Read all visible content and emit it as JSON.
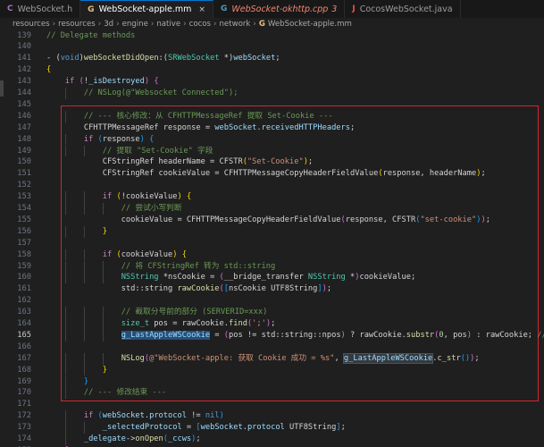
{
  "tabs": [
    {
      "icon": "C",
      "icon_color": "#a074c4",
      "label": "WebSocket.h",
      "active": false
    },
    {
      "icon": "G",
      "icon_color": "#e5c07b",
      "label": "WebSocket-apple.mm",
      "active": true,
      "close": "×"
    },
    {
      "icon": "G",
      "icon_color": "#519aba",
      "label": "WebSocket-okhttp.cpp",
      "problems": "3",
      "active": false,
      "error": true
    },
    {
      "icon": "J",
      "icon_color": "#f14c4c",
      "label": "CocosWebSocket.java",
      "active": false
    }
  ],
  "breadcrumb": [
    "resources",
    "resources",
    "3d",
    "engine",
    "native",
    "cocos",
    "network",
    "WebSocket-apple.mm"
  ],
  "active_line": 165,
  "lines": [
    {
      "n": 139,
      "t": [
        [
          "cm",
          "// Delegate methods"
        ]
      ]
    },
    {
      "n": 140,
      "t": []
    },
    {
      "n": 141,
      "t": [
        [
          "pl",
          "- ("
        ],
        [
          "kw",
          "void"
        ],
        [
          "pl",
          ")"
        ],
        [
          "fn",
          "webSocketDidOpen"
        ],
        [
          "pl",
          ":("
        ],
        [
          "ty",
          "SRWebSocket"
        ],
        [
          "pl",
          " *)"
        ],
        [
          "var",
          "webSocket"
        ],
        [
          "pl",
          ";"
        ]
      ]
    },
    {
      "n": 142,
      "t": [
        [
          "b1",
          "{"
        ]
      ]
    },
    {
      "n": 143,
      "t": [
        [
          "pl",
          "    "
        ],
        [
          "ctl",
          "if"
        ],
        [
          "pl",
          " "
        ],
        [
          "b2",
          "("
        ],
        [
          "pl",
          "!"
        ],
        [
          "var",
          "_isDestroyed"
        ],
        [
          "b2",
          ")"
        ],
        [
          "pl",
          " "
        ],
        [
          "b2",
          "{"
        ]
      ]
    },
    {
      "n": 144,
      "t": [
        [
          "pl",
          "        "
        ],
        [
          "cm",
          "// NSLog(@\"Websocket Connected\");"
        ]
      ]
    },
    {
      "n": 145,
      "t": []
    },
    {
      "n": 146,
      "t": [
        [
          "pl",
          "        "
        ],
        [
          "cm",
          "// --- 核心修改：从 CFHTTPMessageRef 提取 Set-Cookie ---"
        ]
      ]
    },
    {
      "n": 147,
      "t": [
        [
          "pl",
          "        CFHTTPMessageRef response = "
        ],
        [
          "var",
          "webSocket"
        ],
        [
          "pl",
          "."
        ],
        [
          "var",
          "receivedHTTPHeaders"
        ],
        [
          "pl",
          ";"
        ]
      ]
    },
    {
      "n": 148,
      "t": [
        [
          "pl",
          "        "
        ],
        [
          "ctl",
          "if"
        ],
        [
          "pl",
          " "
        ],
        [
          "b3",
          "("
        ],
        [
          "pl",
          "response"
        ],
        [
          "b3",
          ")"
        ],
        [
          "pl",
          " "
        ],
        [
          "b3",
          "{"
        ]
      ]
    },
    {
      "n": 149,
      "t": [
        [
          "pl",
          "            "
        ],
        [
          "cm",
          "// 提取 \"Set-Cookie\" 字段"
        ]
      ]
    },
    {
      "n": 150,
      "t": [
        [
          "pl",
          "            CFStringRef headerName = CFSTR"
        ],
        [
          "b1",
          "("
        ],
        [
          "str",
          "\"Set-Cookie\""
        ],
        [
          "b1",
          ")"
        ],
        [
          "pl",
          ";"
        ]
      ]
    },
    {
      "n": 151,
      "t": [
        [
          "pl",
          "            CFStringRef cookieValue = CFHTTPMessageCopyHeaderFieldValue"
        ],
        [
          "b1",
          "("
        ],
        [
          "pl",
          "response, headerName"
        ],
        [
          "b1",
          ")"
        ],
        [
          "pl",
          ";"
        ]
      ]
    },
    {
      "n": 152,
      "t": []
    },
    {
      "n": 153,
      "t": [
        [
          "pl",
          "            "
        ],
        [
          "ctl",
          "if"
        ],
        [
          "pl",
          " "
        ],
        [
          "b1",
          "("
        ],
        [
          "pl",
          "!cookieValue"
        ],
        [
          "b1",
          ")"
        ],
        [
          "pl",
          " "
        ],
        [
          "b1",
          "{"
        ]
      ]
    },
    {
      "n": 154,
      "t": [
        [
          "pl",
          "                "
        ],
        [
          "cm",
          "// 尝试小写判断"
        ]
      ]
    },
    {
      "n": 155,
      "t": [
        [
          "pl",
          "                cookieValue = CFHTTPMessageCopyHeaderFieldValue"
        ],
        [
          "b2",
          "("
        ],
        [
          "pl",
          "response, CFSTR"
        ],
        [
          "b3",
          "("
        ],
        [
          "str",
          "\"set-cookie\""
        ],
        [
          "b3",
          ")"
        ],
        [
          "b2",
          ")"
        ],
        [
          "pl",
          ";"
        ]
      ]
    },
    {
      "n": 156,
      "t": [
        [
          "pl",
          "            "
        ],
        [
          "b1",
          "}"
        ]
      ]
    },
    {
      "n": 157,
      "t": []
    },
    {
      "n": 158,
      "t": [
        [
          "pl",
          "            "
        ],
        [
          "ctl",
          "if"
        ],
        [
          "pl",
          " "
        ],
        [
          "b1",
          "("
        ],
        [
          "pl",
          "cookieValue"
        ],
        [
          "b1",
          ")"
        ],
        [
          "pl",
          " "
        ],
        [
          "b1",
          "{"
        ]
      ]
    },
    {
      "n": 159,
      "t": [
        [
          "pl",
          "                "
        ],
        [
          "cm",
          "// 将 CFStringRef 转为 std::string"
        ]
      ]
    },
    {
      "n": 160,
      "t": [
        [
          "pl",
          "                "
        ],
        [
          "ty",
          "NSString"
        ],
        [
          "pl",
          " *nsCookie = "
        ],
        [
          "b2",
          "("
        ],
        [
          "pl",
          "__bridge_transfer "
        ],
        [
          "ty",
          "NSString"
        ],
        [
          "pl",
          " *"
        ],
        [
          "b2",
          ")"
        ],
        [
          "pl",
          "cookieValue;"
        ]
      ]
    },
    {
      "n": 161,
      "t": [
        [
          "pl",
          "                std::string "
        ],
        [
          "fn",
          "rawCookie"
        ],
        [
          "b2",
          "("
        ],
        [
          "b3",
          "["
        ],
        [
          "pl",
          "nsCookie UTF8String"
        ],
        [
          "b3",
          "]"
        ],
        [
          "b2",
          ")"
        ],
        [
          "pl",
          ";"
        ]
      ]
    },
    {
      "n": 162,
      "t": []
    },
    {
      "n": 163,
      "t": [
        [
          "pl",
          "                "
        ],
        [
          "cm",
          "// 截取分号前的部分 (SERVERID=xxx)"
        ]
      ]
    },
    {
      "n": 164,
      "t": [
        [
          "pl",
          "                "
        ],
        [
          "ty",
          "size_t"
        ],
        [
          "pl",
          " pos = rawCookie."
        ],
        [
          "fn",
          "find"
        ],
        [
          "b2",
          "("
        ],
        [
          "str",
          "';'"
        ],
        [
          "b2",
          ")"
        ],
        [
          "pl",
          ";"
        ]
      ]
    },
    {
      "n": 165,
      "t": [
        [
          "pl",
          "                "
        ],
        [
          "var sel",
          "g_LastAppleWSCookie"
        ],
        [
          "pl",
          " = "
        ],
        [
          "b2",
          "("
        ],
        [
          "pl",
          "pos != std::string::npos"
        ],
        [
          "b2",
          ")"
        ],
        [
          "pl",
          " ? rawCookie."
        ],
        [
          "fn",
          "substr"
        ],
        [
          "b2",
          "("
        ],
        [
          "num",
          "0"
        ],
        [
          "pl",
          ", pos"
        ],
        [
          "b2",
          ")"
        ],
        [
          "pl",
          " : rawCookie; "
        ],
        [
          "cm",
          "// "
        ]
      ]
    },
    {
      "n": 166,
      "t": []
    },
    {
      "n": 167,
      "t": [
        [
          "pl",
          "                "
        ],
        [
          "fn",
          "NSLog"
        ],
        [
          "b2",
          "("
        ],
        [
          "str",
          "@\"WebSocket-apple: 获取 Cookie 成功 = %s\""
        ],
        [
          "pl",
          ", "
        ],
        [
          "var occ",
          "g_LastAppleWSCookie"
        ],
        [
          "pl",
          "."
        ],
        [
          "fn",
          "c_str"
        ],
        [
          "b3",
          "()"
        ],
        [
          "b2",
          ")"
        ],
        [
          "pl",
          ";"
        ]
      ]
    },
    {
      "n": 168,
      "t": [
        [
          "pl",
          "            "
        ],
        [
          "b1",
          "}"
        ]
      ]
    },
    {
      "n": 169,
      "t": [
        [
          "pl",
          "        "
        ],
        [
          "b3",
          "}"
        ]
      ]
    },
    {
      "n": 170,
      "t": [
        [
          "pl",
          "        "
        ],
        [
          "cm",
          "// --- 修改结束 ---"
        ]
      ]
    },
    {
      "n": 171,
      "t": []
    },
    {
      "n": 172,
      "t": [
        [
          "pl",
          "        "
        ],
        [
          "ctl",
          "if"
        ],
        [
          "pl",
          " "
        ],
        [
          "b3",
          "("
        ],
        [
          "var",
          "webSocket"
        ],
        [
          "pl",
          "."
        ],
        [
          "var",
          "protocol"
        ],
        [
          "pl",
          " != "
        ],
        [
          "kw",
          "nil"
        ],
        [
          "b3",
          ")"
        ]
      ]
    },
    {
      "n": 173,
      "t": [
        [
          "pl",
          "            "
        ],
        [
          "var",
          "_selectedProtocol"
        ],
        [
          "pl",
          " = "
        ],
        [
          "b3",
          "["
        ],
        [
          "var",
          "webSocket"
        ],
        [
          "pl",
          "."
        ],
        [
          "var",
          "protocol"
        ],
        [
          "pl",
          " UTF8String"
        ],
        [
          "b3",
          "]"
        ],
        [
          "pl",
          ";"
        ]
      ]
    },
    {
      "n": 174,
      "t": [
        [
          "pl",
          "        "
        ],
        [
          "var",
          "_delegate"
        ],
        [
          "pl",
          "->"
        ],
        [
          "fn",
          "onOpen"
        ],
        [
          "b3",
          "("
        ],
        [
          "var",
          "_ccws"
        ],
        [
          "b3",
          ")"
        ],
        [
          "pl",
          ";"
        ]
      ]
    },
    {
      "n": 175,
      "t": [
        [
          "pl",
          "    "
        ],
        [
          "b2",
          "}"
        ]
      ]
    }
  ]
}
